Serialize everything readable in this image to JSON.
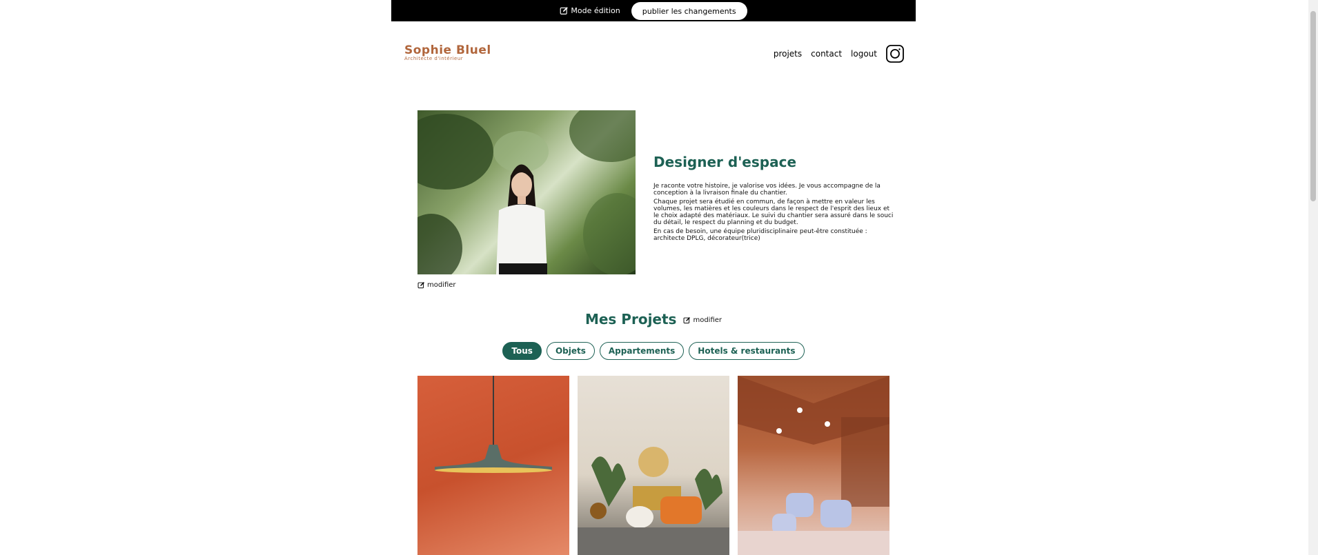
{
  "edit_bar": {
    "mode_label": "Mode édition",
    "publish_label": "publier les changements"
  },
  "logo": {
    "name": "Sophie Bluel",
    "subtitle": "Architecte d'intérieur"
  },
  "nav": {
    "items": [
      "projets",
      "contact",
      "logout"
    ],
    "social_icon": "instagram-icon"
  },
  "introduction": {
    "photo_alt": "Sophie Bluel",
    "modifier_label": "modifier",
    "title": "Designer d'espace",
    "paragraphs": [
      "Je raconte votre histoire, je valorise vos idées. Je vous accompagne de la conception à la livraison finale du chantier.",
      "Chaque projet sera étudié en commun, de façon à mettre en valeur les volumes, les matières et les couleurs dans le respect de l'esprit des lieux et le choix adapté des matériaux. Le suivi du chantier sera assuré dans le souci du détail, le respect du planning et du budget.",
      "En cas de besoin, une équipe pluridisciplinaire peut-être constituée : architecte DPLG, décorateur(trice)"
    ]
  },
  "portfolio": {
    "title": "Mes Projets",
    "modifier_label": "modifier",
    "filters": [
      {
        "label": "Tous",
        "active": true
      },
      {
        "label": "Objets",
        "active": false
      },
      {
        "label": "Appartements",
        "active": false
      },
      {
        "label": "Hotels & restaurants",
        "active": false
      }
    ],
    "gallery": [
      "pendant-lamp-image",
      "living-room-image",
      "restaurant-image"
    ]
  },
  "colors": {
    "brand": "#B1663C",
    "accent": "#1D6154",
    "edit_bar": "#000000"
  }
}
